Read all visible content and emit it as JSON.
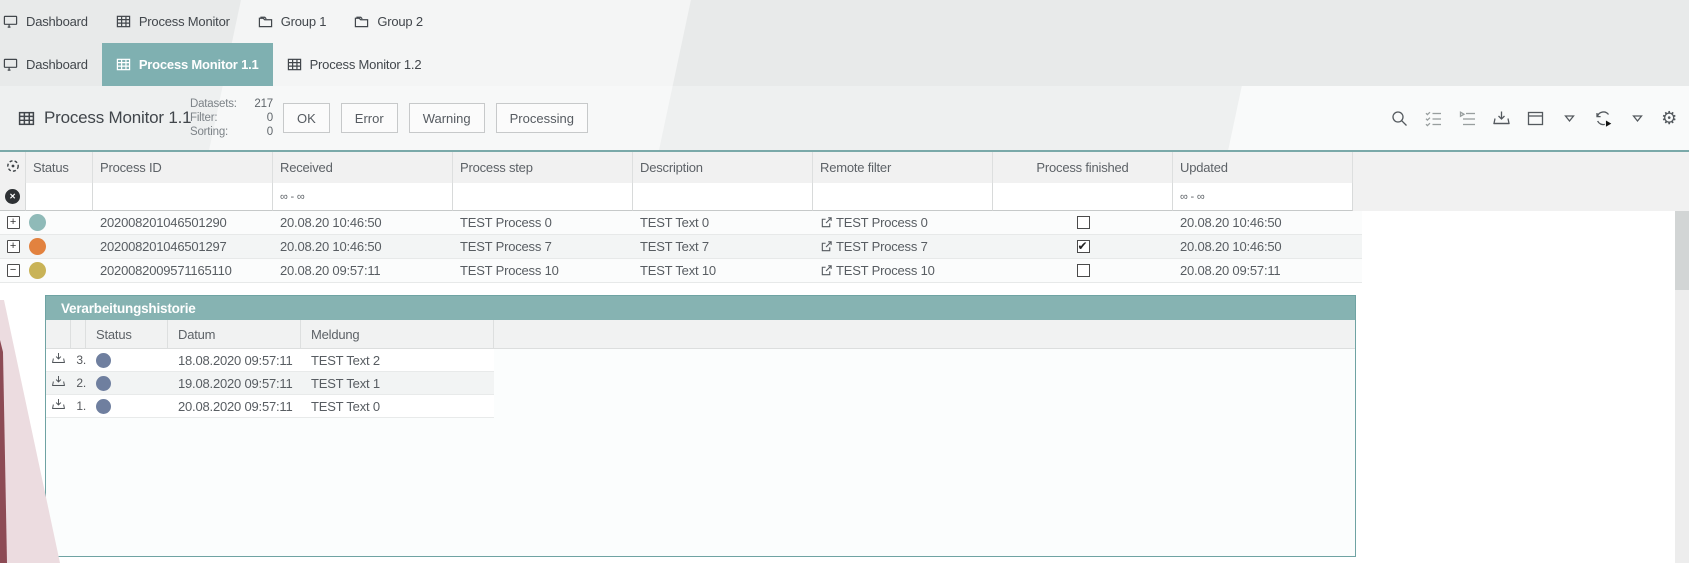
{
  "tabs_level1": {
    "items": [
      {
        "icon": "dashboard-icon",
        "label": "Dashboard"
      },
      {
        "icon": "grid-icon",
        "label": "Process Monitor"
      },
      {
        "icon": "folder-icon",
        "label": "Group 1"
      },
      {
        "icon": "folder-icon",
        "label": "Group 2"
      }
    ]
  },
  "tabs_level2": {
    "items": [
      {
        "icon": "dashboard-icon",
        "label": "Dashboard",
        "active": false
      },
      {
        "icon": "grid-icon",
        "label": "Process Monitor 1.1",
        "active": true
      },
      {
        "icon": "grid-icon",
        "label": "Process Monitor 1.2",
        "active": false
      }
    ]
  },
  "panel": {
    "title": "Process Monitor 1.1",
    "stats": [
      {
        "label": "Datasets:",
        "value": "217"
      },
      {
        "label": "Filter:",
        "value": "0"
      },
      {
        "label": "Sorting:",
        "value": "0"
      }
    ],
    "filter_buttons": [
      "OK",
      "Error",
      "Warning",
      "Processing"
    ],
    "toolbar_icons": [
      "search-icon",
      "checklist-icon",
      "playlist-icon",
      "download-icon",
      "window-icon",
      "caret-down-icon",
      "refresh-run-icon",
      "caret-down-icon",
      "gear-icon"
    ],
    "gear_glyph": "⚙"
  },
  "table": {
    "columns": [
      "Status",
      "Process ID",
      "Received",
      "Process step",
      "Description",
      "Remote filter",
      "Process finished",
      "Updated"
    ],
    "filter_row": {
      "received": "∞ - ∞",
      "updated": "∞ - ∞",
      "clear_glyph": "✕"
    },
    "rows": [
      {
        "expand": "+",
        "status_color": "#8FBAB8",
        "process_id": "202008201046501290",
        "received": "20.08.20 10:46:50",
        "process_step": "TEST Process 0",
        "description": "TEST Text 0",
        "remote_filter": "TEST Process 0",
        "finished": false,
        "updated": "20.08.20 10:46:50"
      },
      {
        "expand": "+",
        "status_color": "#E2823F",
        "process_id": "202008201046501297",
        "received": "20.08.20 10:46:50",
        "process_step": "TEST Process 7",
        "description": "TEST Text 7",
        "remote_filter": "TEST Process 7",
        "finished": true,
        "updated": "20.08.20 10:46:50"
      },
      {
        "expand": "−",
        "status_color": "#C9B357",
        "process_id": "2020082009571165110",
        "received": "20.08.20 09:57:11",
        "process_step": "TEST Process 10",
        "description": "TEST Text 10",
        "remote_filter": "TEST Process 10",
        "finished": false,
        "updated": "20.08.20 09:57:11"
      }
    ]
  },
  "detail": {
    "title": "Verarbeitungshistorie",
    "columns": [
      "Status",
      "Datum",
      "Meldung"
    ],
    "status_color": "#6F7F9F",
    "rows": [
      {
        "num": "3.",
        "datum": "18.08.2020 09:57:11",
        "meldung": "TEST Text 2"
      },
      {
        "num": "2.",
        "datum": "19.08.2020 09:57:11",
        "meldung": "TEST Text 1"
      },
      {
        "num": "1.",
        "datum": "20.08.2020 09:57:11",
        "meldung": "TEST Text 0"
      }
    ]
  },
  "colors": {
    "accent_teal": "#7FB0B1",
    "detail_header_teal": "#86B3B2",
    "band_gray": "#E8EAEA",
    "maroon": "#8D4B55",
    "pink": "#ECDCE0"
  }
}
